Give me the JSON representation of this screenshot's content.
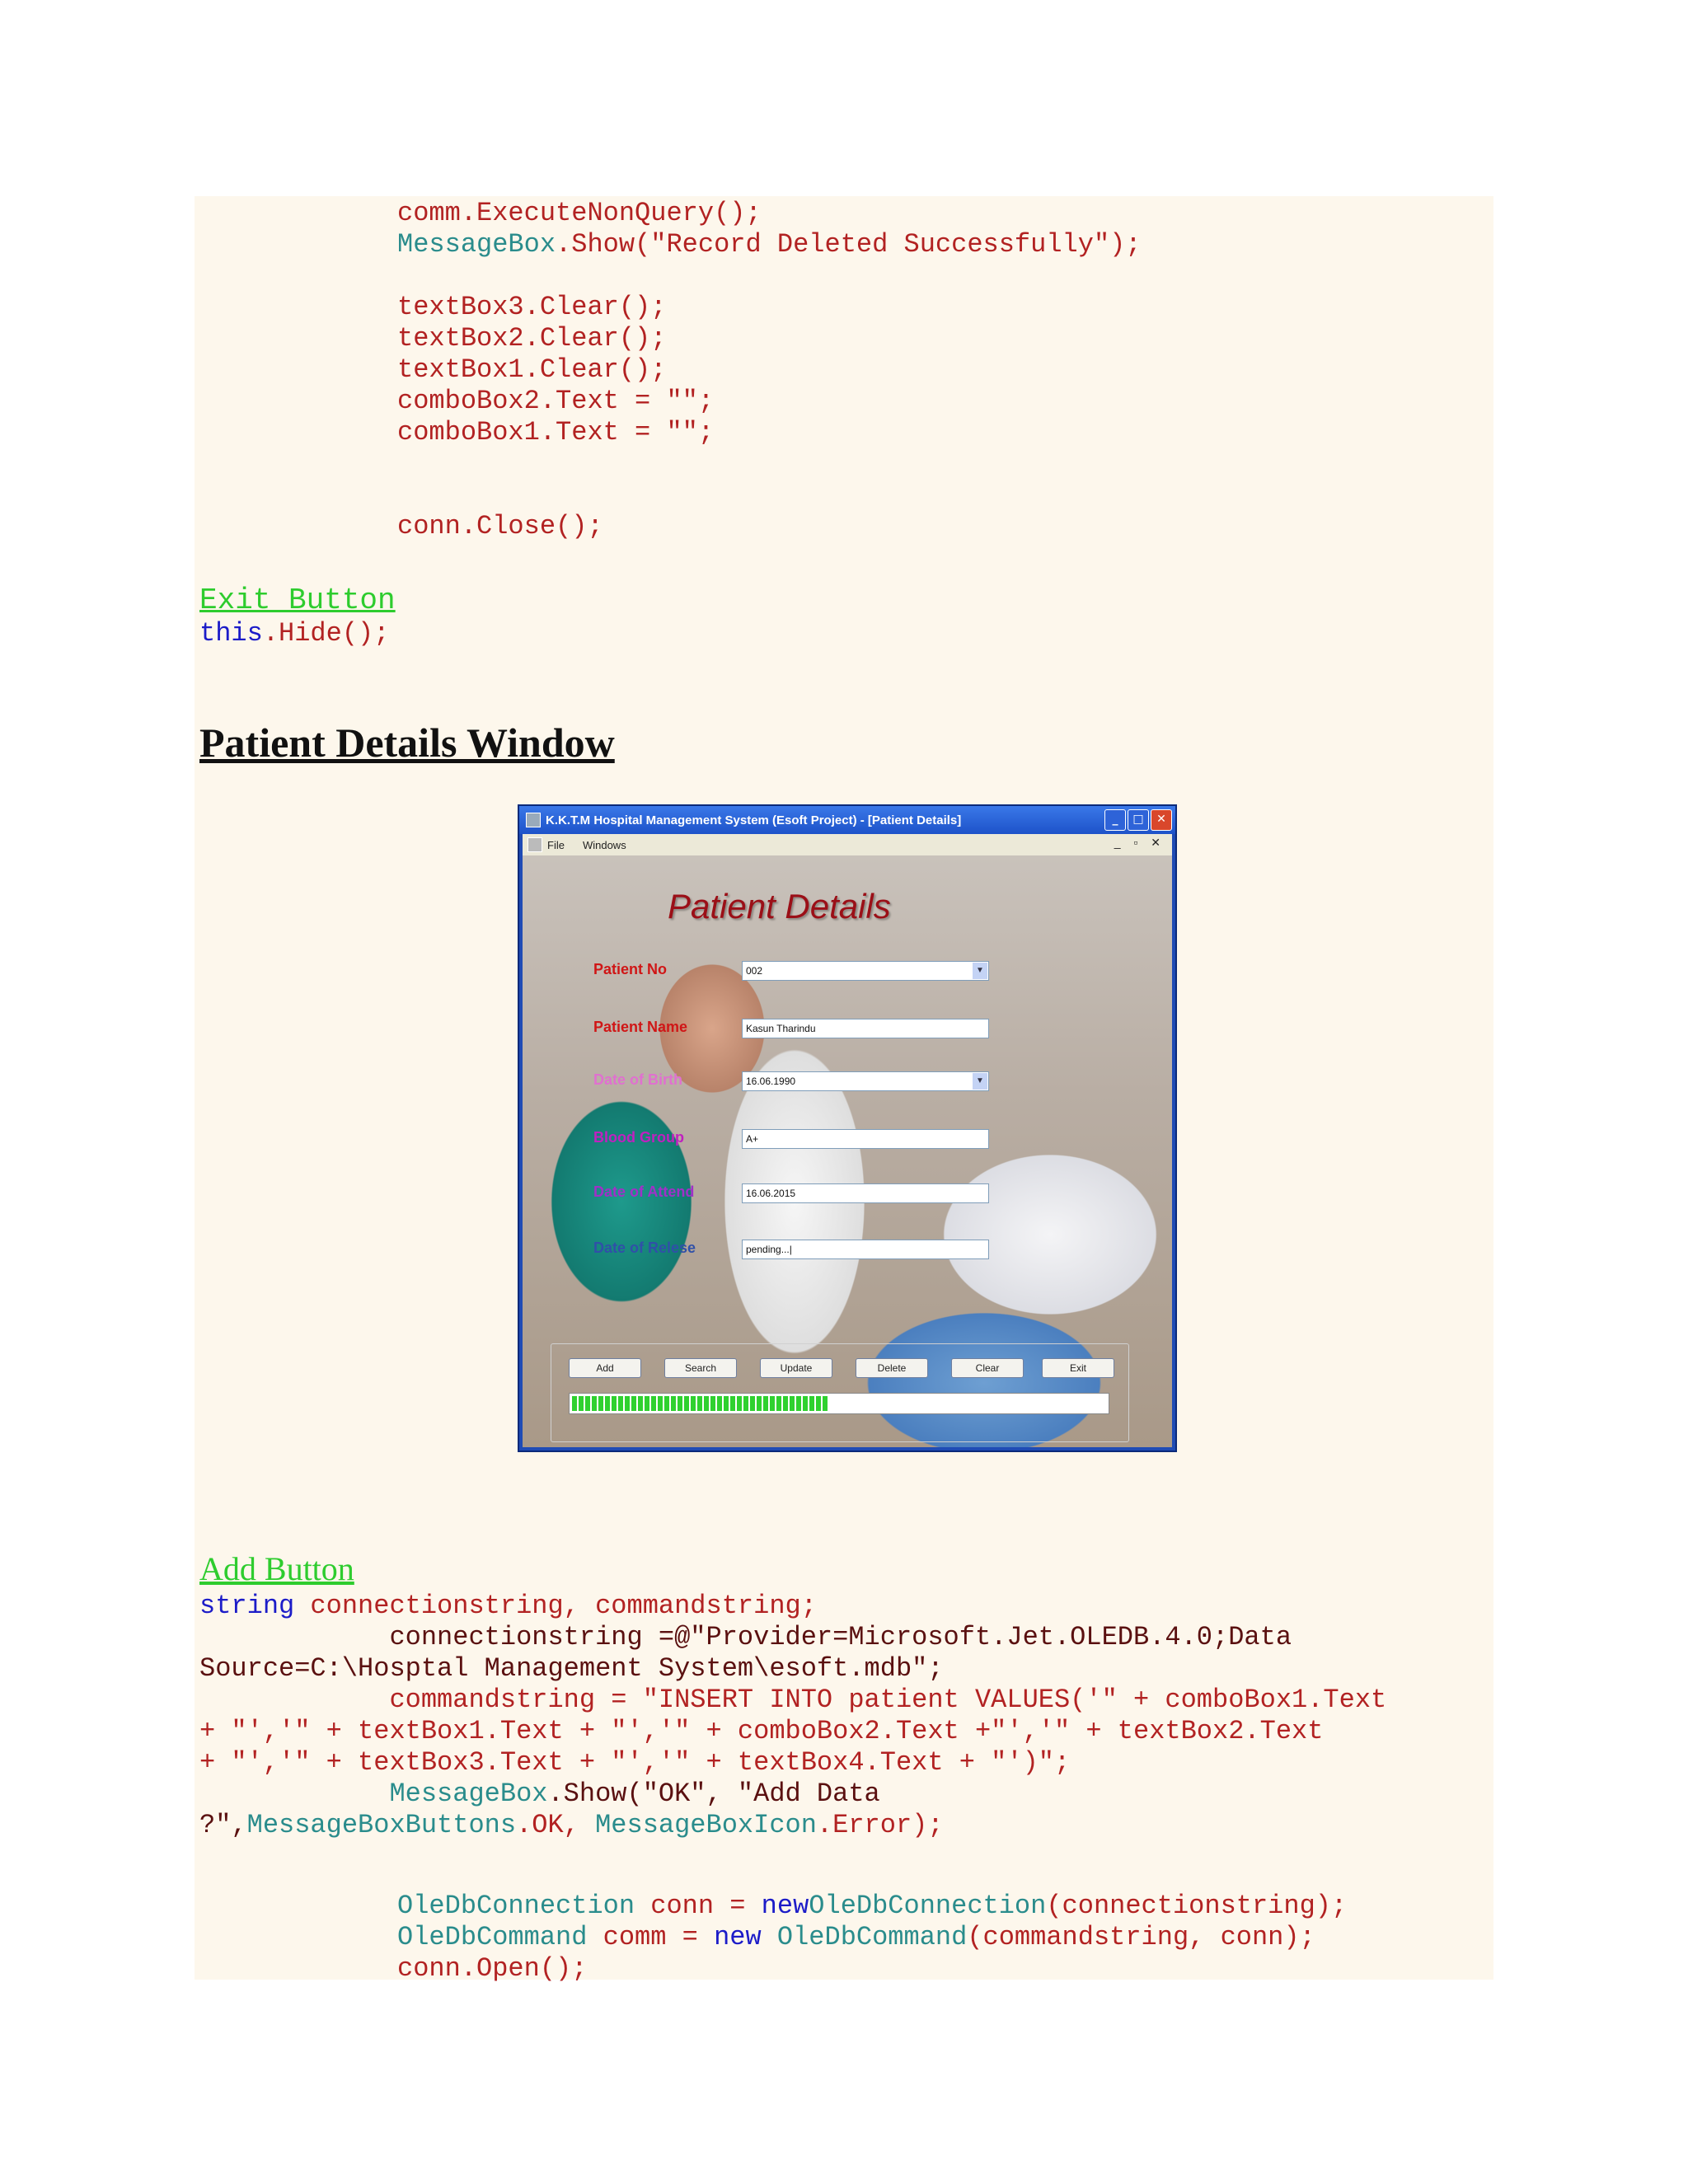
{
  "code_top": {
    "line1": "comm.ExecuteNonQuery();",
    "line2_type": "MessageBox",
    "line2_rest": ".Show(\"Record Deleted Successfully\");",
    "line3": "textBox3.Clear();",
    "line4": "textBox2.Clear();",
    "line5": "textBox1.Clear();",
    "line6": "comboBox2.Text = \"\";",
    "line7": "comboBox1.Text = \"\";",
    "line8": "conn.Close();"
  },
  "exit_section": {
    "label": "Exit Button",
    "code_this": "this",
    "code_rest": ".Hide();"
  },
  "heading": "Patient Details Window",
  "window": {
    "title": "K.K.T.M Hospital Management System (Esoft Project) - [Patient Details]",
    "menu": [
      "File",
      "Windows"
    ],
    "form_title": "Patient Details",
    "fields": [
      {
        "label": "Patient No",
        "value": "002",
        "color": "#d01616"
      },
      {
        "label": "Patient Name",
        "value": "Kasun Tharindu",
        "color": "#d01616"
      },
      {
        "label": "Date of Birth",
        "value": "16.06.1990",
        "color": "#e070d0"
      },
      {
        "label": "Blood Group",
        "value": "A+",
        "color": "#c020c0"
      },
      {
        "label": "Date of Attend",
        "value": "16.06.2015",
        "color": "#a030c8"
      },
      {
        "label": "Date of Relese",
        "value": "pending...|",
        "color": "#3050a8"
      }
    ],
    "buttons": [
      "Add",
      "Search",
      "Update",
      "Delete",
      "Clear",
      "Exit"
    ],
    "progress_fraction": 0.48
  },
  "add_section": {
    "label": "Add Button",
    "l1_kw": "string",
    "l1_rest": " connectionstring, commandstring;",
    "l2": "            connectionstring =@\"Provider=Microsoft.Jet.OLEDB.4.0;Data",
    "l3": "Source=C:\\Hosptal Management System\\esoft.mdb\";",
    "l4": "            commandstring = \"INSERT INTO patient VALUES('\" + comboBox1.Text",
    "l5": "+ \"','\" + textBox1.Text + \"','\" + comboBox2.Text +\"','\" + textBox2.Text",
    "l6": "+ \"','\" + textBox3.Text + \"','\" + textBox4.Text + \"')\";",
    "l7_indent": "            ",
    "l7_type": "MessageBox",
    "l7_rest": ".Show(\"OK\", \"Add Data",
    "l8_a": "?\",",
    "l8_type1": "MessageBoxButtons",
    "l8_b": ".OK, ",
    "l8_type2": "MessageBoxIcon",
    "l8_c": ".Error);",
    "l9_type": "OleDbConnection",
    "l9_a": " conn = ",
    "l9_kw": "new",
    "l9_type2": "OleDbConnection",
    "l9_b": "(connectionstring);",
    "l10_type": "OleDbCommand",
    "l10_a": " comm = ",
    "l10_kw": "new",
    "l10_type2": " OleDbCommand",
    "l10_b": "(commandstring, conn);",
    "l11": "conn.Open();"
  }
}
